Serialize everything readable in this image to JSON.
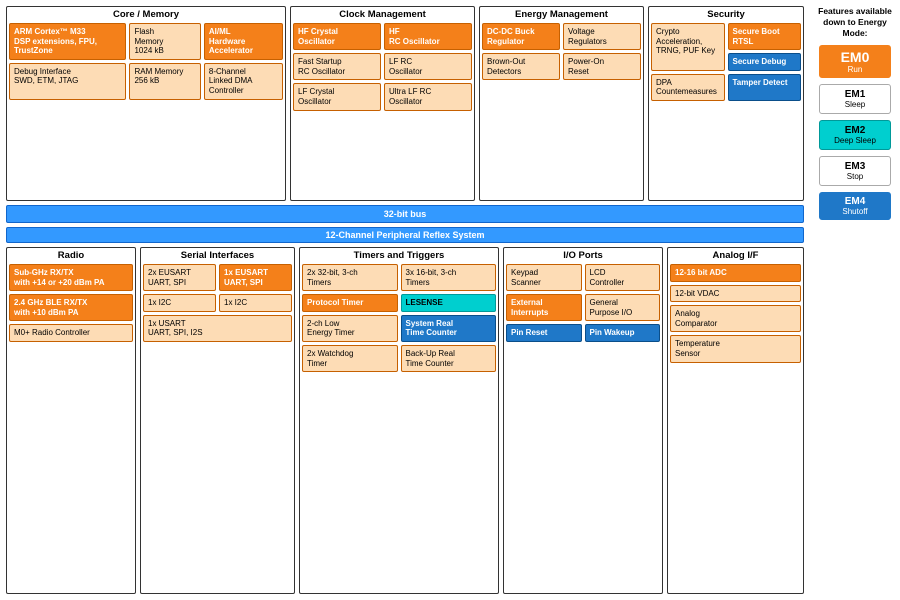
{
  "header": {
    "core_memory": "Core / Memory",
    "clock_management": "Clock Management",
    "energy_management": "Energy Management",
    "security": "Security"
  },
  "core": {
    "arm": "ARM Cortex™ M33\nDSP extensions, FPU,\nTrustZone",
    "flash": "Flash\nMemory\n1024 kB",
    "aiml": "AI/ML\nHardware\nAccelerator",
    "debug": "Debug Interface\nSWD, ETM, JTAG",
    "ram": "RAM Memory\n256 kB",
    "dma": "8-Channel\nLinked DMA\nController"
  },
  "clock": {
    "hf_crystal": "HF Crystal\nOscillator",
    "hf_rc": "HF\nRC Oscillator",
    "fast_startup": "Fast Startup\nRC Oscillator",
    "lf_rc": "LF RC\nOscillator",
    "lf_crystal": "LF Crystal\nOscillator",
    "ultra_lf_rc": "Ultra LF RC\nOscillator"
  },
  "energy": {
    "dcdc": "DC-DC Buck\nRegulator",
    "voltage_reg": "Voltage\nRegulators",
    "brownout": "Brown-Out\nDetectors",
    "power_on": "Power-On\nReset"
  },
  "security": {
    "crypto": "Crypto\nAcceleration,\nTRNG, PUF Key",
    "secure_boot": "Secure Boot\nRTSL",
    "dpa": "DPA\nCountemeasures",
    "tamper": "Tamper Detect",
    "secure_debug": "Secure Debug"
  },
  "bus": {
    "bus32": "32-bit bus",
    "bus12": "12-Channel Peripheral Reflex System"
  },
  "radio": {
    "title": "Radio",
    "subghz": "Sub-GHz RX/TX\nwith +14 or +20 dBm PA",
    "ble": "2.4 GHz BLE RX/TX\nwith +10 dBm PA",
    "m0plus": "M0+ Radio Controller"
  },
  "serial": {
    "title": "Serial Interfaces",
    "eusart2": "2x EUSART\nUART, SPI",
    "eusart1": "1x EUSART\nUART, SPI",
    "i2c_left": "1x I2C",
    "i2c_right": "1x I2C",
    "usart": "1x USART\nUART, SPI, I2S"
  },
  "timers": {
    "title": "Timers and Triggers",
    "timers32": "2x 32-bit, 3-ch\nTimers",
    "timers16": "3x 16-bit, 3-ch\nTimers",
    "protocol": "Protocol Timer",
    "lesense": "LESENSE",
    "low_energy": "2-ch Low\nEnergy Timer",
    "system_rtc": "System Real\nTime Counter",
    "watchdog": "2x Watchdog\nTimer",
    "backup_rtc": "Back-Up Real\nTime Counter"
  },
  "io": {
    "title": "I/O Ports",
    "keypad": "Keypad\nScanner",
    "lcd": "LCD\nController",
    "ext_int": "External\nInterrupts",
    "gpio": "General\nPurpose I/O",
    "pin_reset": "Pin Reset",
    "pin_wakeup": "Pin Wakeup"
  },
  "analog": {
    "title": "Analog I/F",
    "adc": "12-16 bit ADC",
    "vdac": "12-bit VDAC",
    "comparator": "Analog\nComparator",
    "temp": "Temperature\nSensor"
  },
  "features": {
    "label": "Features\navailable\ndown to\nEnergy Mode:",
    "em0": "EM0",
    "em0_sub": "Run",
    "em1": "EM1",
    "em1_sub": "Sleep",
    "em2": "EM2",
    "em2_sub": "Deep Sleep",
    "em3": "EM3",
    "em3_sub": "Stop",
    "em4": "EM4",
    "em4_sub": "Shutoff"
  }
}
